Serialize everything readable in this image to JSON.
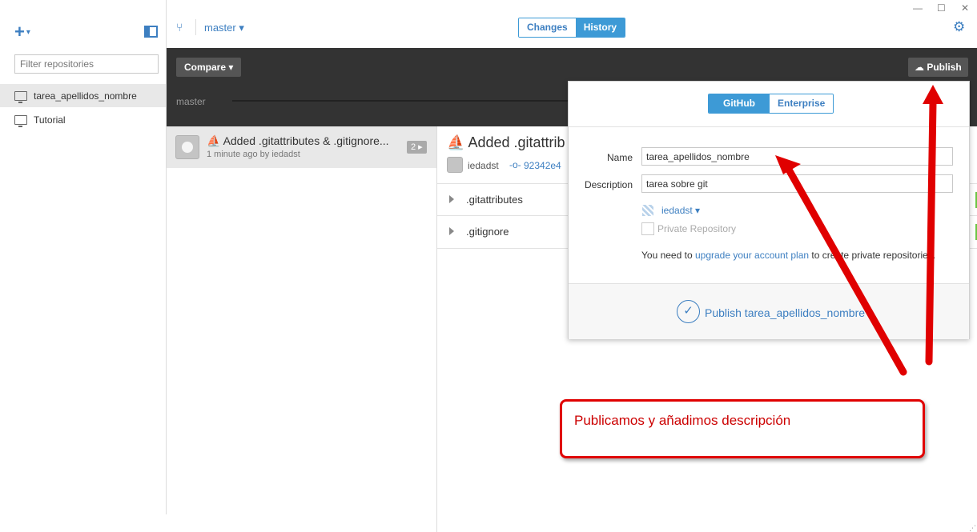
{
  "window": {
    "minimize_icon": "—",
    "maximize_icon": "☐",
    "close_icon": "✕"
  },
  "sidebar": {
    "add_icon": "+",
    "add_caret": "▾",
    "filter_placeholder": "Filter repositories",
    "repos": [
      {
        "name": "tarea_apellidos_nombre",
        "active": true
      },
      {
        "name": "Tutorial",
        "active": false
      }
    ]
  },
  "topbar": {
    "branch_icon": "⑂",
    "branch": "master ▾",
    "tabs": [
      {
        "label": "Changes"
      },
      {
        "label": "History"
      }
    ],
    "settings_icon": "⚙"
  },
  "compare_bar": {
    "compare_label": "Compare ▾",
    "publish_label": "Publish",
    "publish_icon": "☁",
    "branch_label": "master"
  },
  "commit": {
    "icon": "⛵",
    "title": "Added .gitattributes & .gitignore...",
    "meta": "1 minute ago by iedadst",
    "count": "2 ▸"
  },
  "detail": {
    "title": "Added .gitattrib",
    "author": "iedadst",
    "sha_icon": "-o-",
    "sha": "92342e4",
    "files": [
      ".gitattributes",
      ".gitignore"
    ]
  },
  "publish_popover": {
    "tabs": [
      {
        "label": "GitHub"
      },
      {
        "label": "Enterprise"
      }
    ],
    "name_label": "Name",
    "name_value": "tarea_apellidos_nombre",
    "description_label": "Description",
    "description_value": "tarea sobre git",
    "owner": "iedadst ▾",
    "private_label": "Private Repository",
    "upgrade_prefix": "You need to ",
    "upgrade_link": "upgrade your account plan",
    "upgrade_suffix": " to create private repositories.",
    "check_icon": "✓",
    "action_label": "Publish tarea_apellidos_nombre"
  },
  "annotation": {
    "text": "Publicamos y añadimos descripción",
    "color": "#e00000"
  },
  "colors": {
    "accent": "#3d9ad6",
    "link": "#3d7fc1",
    "dark_bar": "#333333"
  }
}
